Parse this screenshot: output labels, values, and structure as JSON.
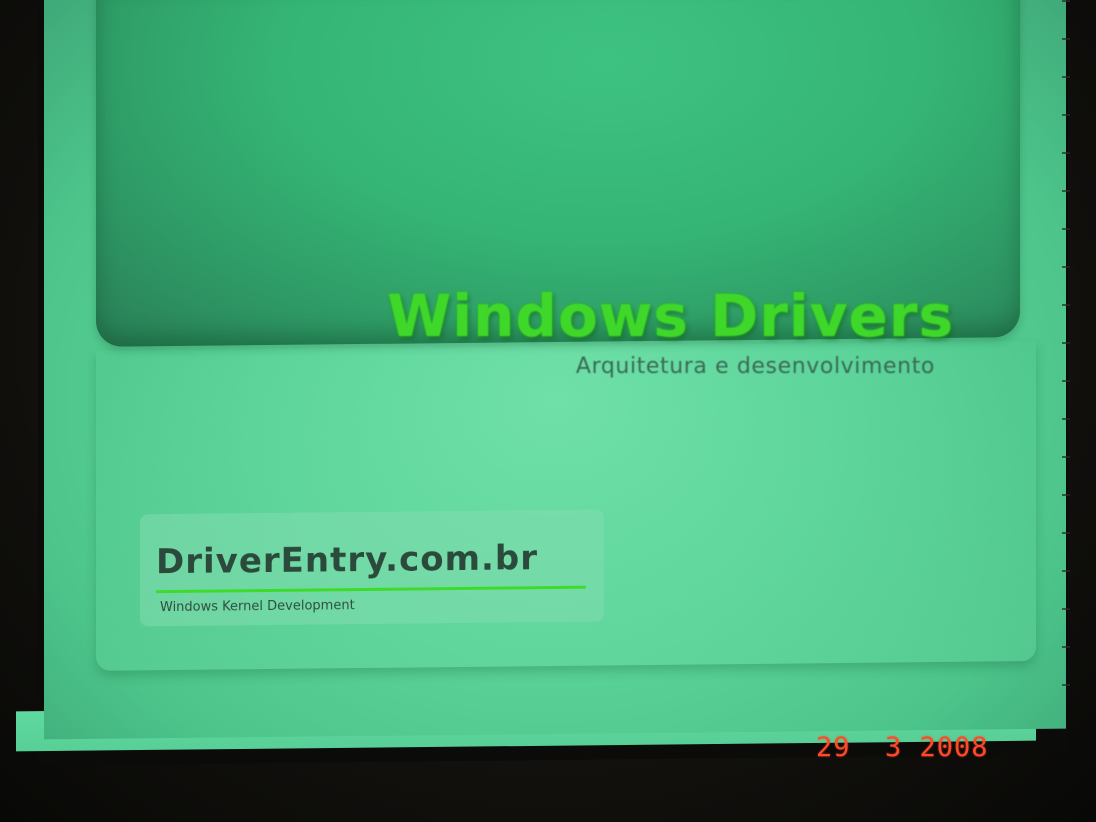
{
  "slide": {
    "title": "Windows Drivers",
    "subtitle": "Arquitetura e desenvolvimento",
    "logo": {
      "name": "DriverEntry.com.br",
      "tagline": "Windows Kernel Development"
    }
  },
  "camera": {
    "date_stamp": "29  3 2008"
  },
  "colors": {
    "slide_background": "#5cd49a",
    "title_green": "#3fd82a",
    "subtitle_text": "#3a6a56",
    "date_stamp_red": "#ff4a2a"
  }
}
